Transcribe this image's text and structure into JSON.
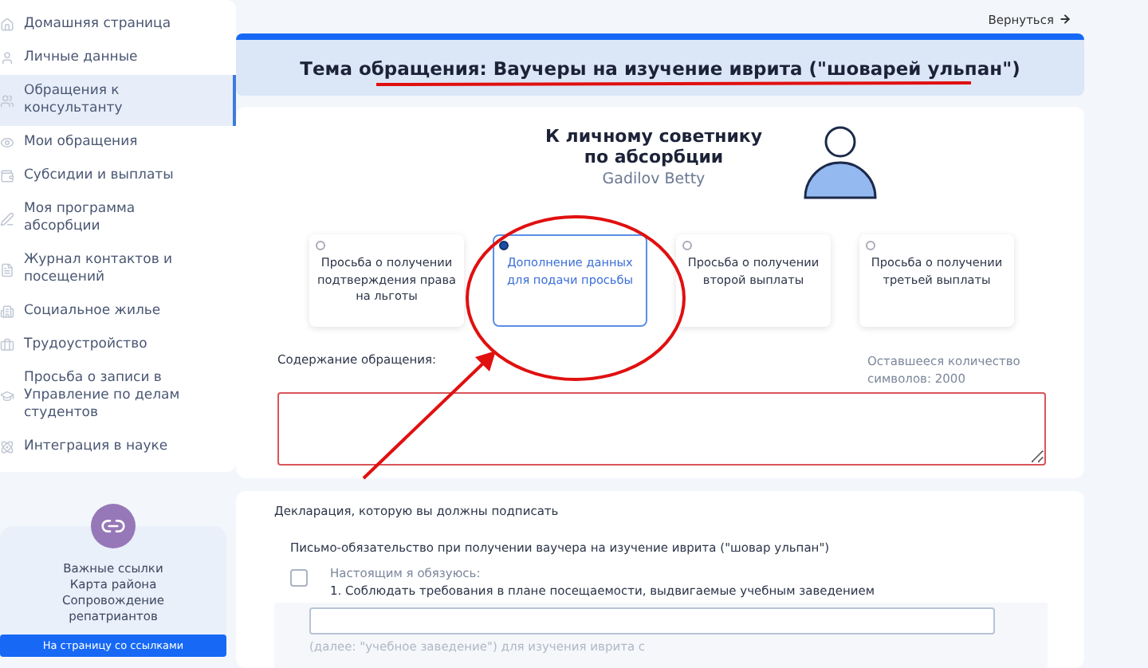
{
  "sidebar": {
    "items": [
      {
        "label": "Домашняя страница",
        "selected": false
      },
      {
        "label": "Личные данные",
        "selected": false
      },
      {
        "label": "Обращения к консультанту",
        "selected": true
      },
      {
        "label": "Мои обращения",
        "selected": false
      },
      {
        "label": "Субсидии и выплаты",
        "selected": false
      },
      {
        "label": "Моя программа абсорбции",
        "selected": false
      },
      {
        "label": "Журнал контактов и посещений",
        "selected": false
      },
      {
        "label": "Социальное жилье",
        "selected": false
      },
      {
        "label": "Трудоустройство",
        "selected": false
      },
      {
        "label": "Просьба о записи в Управление по делам студентов",
        "selected": false
      },
      {
        "label": "Интеграция в науке",
        "selected": false
      }
    ],
    "links_card": {
      "lines": [
        "Важные ссылки",
        "Карта района",
        "Сопровождение репатриантов"
      ],
      "button": "На страницу со ссылками"
    }
  },
  "back_link": "Вернуться",
  "subject": "Тема обращения: Ваучеры на изучение иврита (\"шоварей ульпан\")",
  "recipient": {
    "title": "К личному советнику по абсорбции",
    "name": "Gadilov Betty"
  },
  "options": [
    {
      "label": "Просьба о получении подтверждения права на льготы",
      "selected": false
    },
    {
      "label": "Дополнение данных для подачи просьбы",
      "selected": true
    },
    {
      "label": "Просьба о получении второй выплаты",
      "selected": false
    },
    {
      "label": "Просьба о получении третьей выплаты",
      "selected": false
    }
  ],
  "content": {
    "label": "Содержание обращения:",
    "counter": "Оставшееся количество символов: 2000",
    "invalid": true
  },
  "declaration": {
    "label": "Декларация, которую вы должны подписать",
    "title": "Письмо-обязательство при получении ваучера на изучение иврита (\"шовар ульпан\")",
    "checked": false,
    "lines": [
      "Настоящим я обязуюсь:",
      "1. Соблюдать требования в плане посещаемости, выдвигаемые учебным заведением"
    ],
    "hint": "(далее: \"учебное заведение\") для изучения иврита с"
  }
}
